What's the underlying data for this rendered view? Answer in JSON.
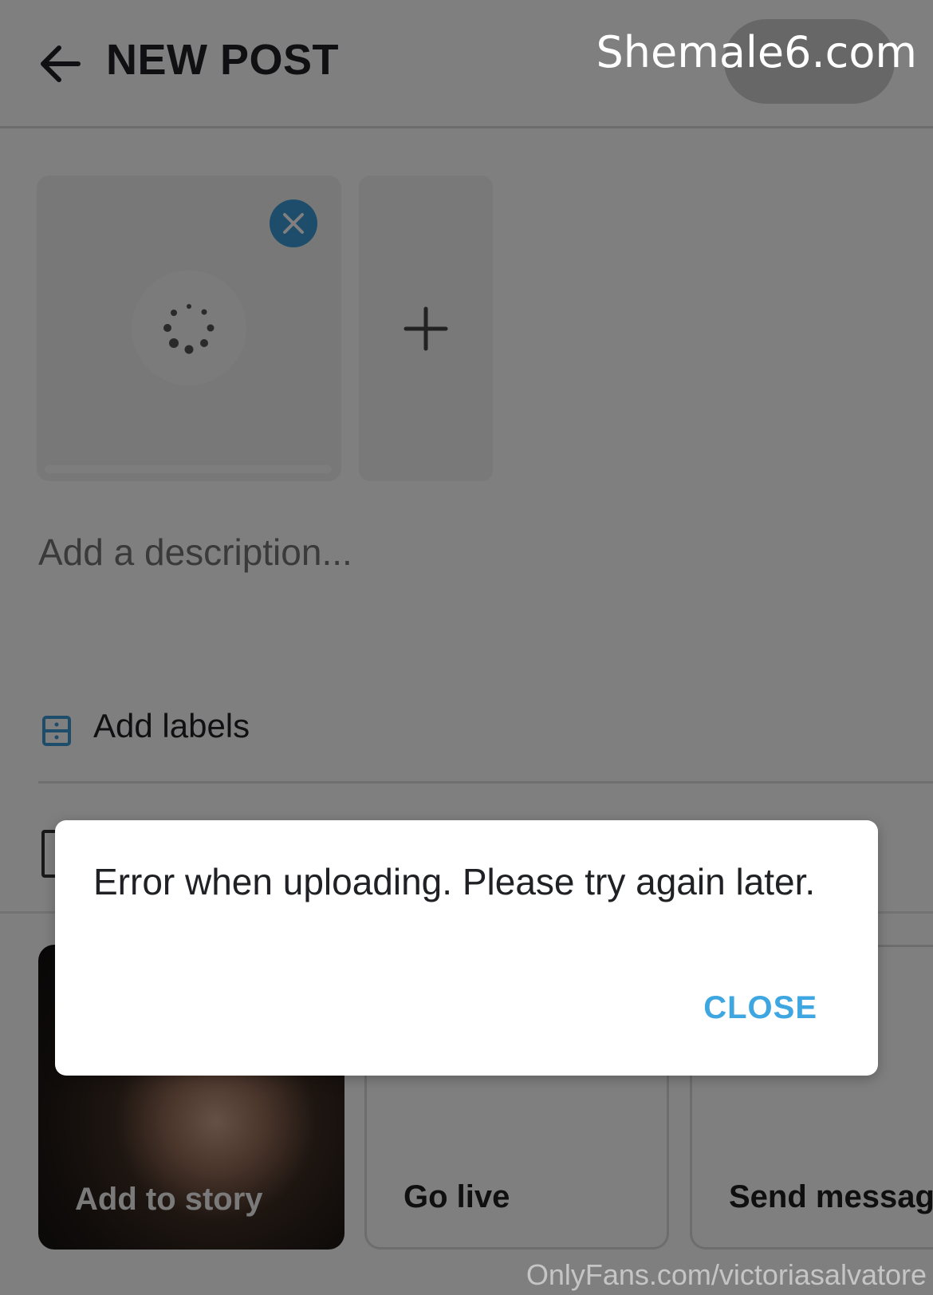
{
  "header": {
    "title": "NEW POST",
    "watermark": "Shemale6.com"
  },
  "media": {
    "upload_progress": 0.0
  },
  "description": {
    "placeholder": "Add a description..."
  },
  "labels_row": {
    "label": "Add labels"
  },
  "actions": [
    {
      "label": "Add to story"
    },
    {
      "label": "Go live"
    },
    {
      "label": "Send message"
    }
  ],
  "dialog": {
    "message": "Error when uploading. Please try again later.",
    "close_label": "CLOSE",
    "accent_color": "#3ea6e0"
  },
  "footer": {
    "watermark": "OnlyFans.com/victoriasalvatore"
  },
  "colors": {
    "remove_button": "#3a9bd5",
    "scrim": "rgba(0,0,0,0.5)"
  }
}
